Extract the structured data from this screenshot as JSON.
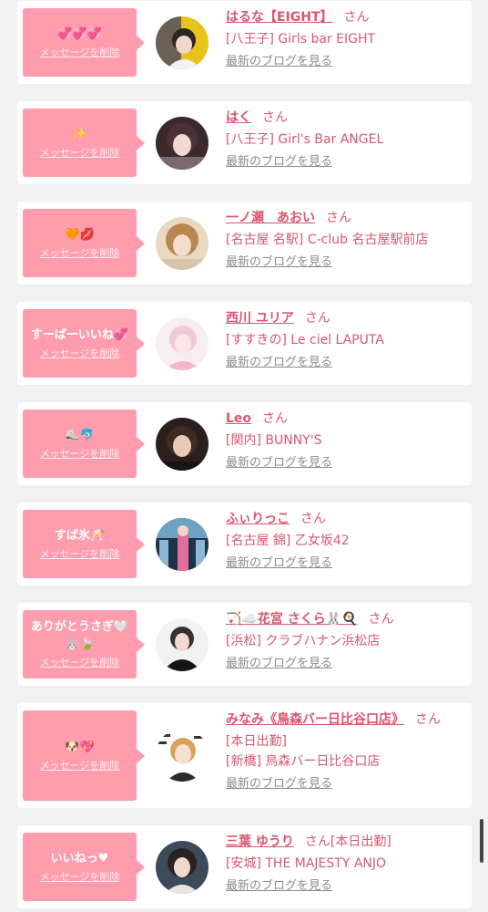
{
  "ui": {
    "delete_label": "メッセージを削除",
    "blog_label": "最新のブログを見る",
    "honorific": "さん",
    "colors": {
      "accent": "#d9566f",
      "bubble": "#ff9cae",
      "link_gray": "#8d8d8d",
      "background": "#f1f1f3"
    }
  },
  "messages": [
    {
      "message": "💞💞💞",
      "name": "はるな【EIGHT】",
      "name_suffix": "",
      "shop_lines": [
        "[八王子] Girls bar EIGHT"
      ]
    },
    {
      "message": "✨",
      "name": "はく",
      "name_suffix": "",
      "shop_lines": [
        "[八王子] Girl's Bar ANGEL"
      ]
    },
    {
      "message": "🧡💋",
      "name": "一ノ瀬　あおい",
      "name_suffix": "",
      "shop_lines": [
        "[名古屋 名駅] C-club 名古屋駅前店"
      ]
    },
    {
      "message": "すーぱーいいね💞",
      "name": "西川 ユリア",
      "name_suffix": "",
      "shop_lines": [
        "[すすきの] Le ciel LAPUTA"
      ]
    },
    {
      "message": "⛸️🐬",
      "name": "Leo",
      "name_suffix": "",
      "shop_lines": [
        "[関内] BUNNY'S"
      ]
    },
    {
      "message": "すば氷🥂",
      "name": "ふぃりっこ",
      "name_suffix": "",
      "shop_lines": [
        "[名古屋 錦] 乙女坂42"
      ]
    },
    {
      "message": "ありがとうさぎ🤍🐰🍃",
      "name": "🏹☁️花宮 さくら🐰🍳",
      "name_suffix": "",
      "shop_lines": [
        "[浜松] クラブハナン浜松店"
      ]
    },
    {
      "message": "🐶💖",
      "name": "みなみ《鳥森バー日比谷口店》",
      "name_suffix": "",
      "shop_lines": [
        "[本日出勤]",
        "[新橋] 鳥森バー日比谷口店"
      ]
    },
    {
      "message": "いいねっ♥",
      "name": "三葉 ゆうり",
      "name_suffix": "[本日出勤]",
      "shop_lines": [
        "[安城] THE MAJESTY ANJO"
      ]
    }
  ]
}
